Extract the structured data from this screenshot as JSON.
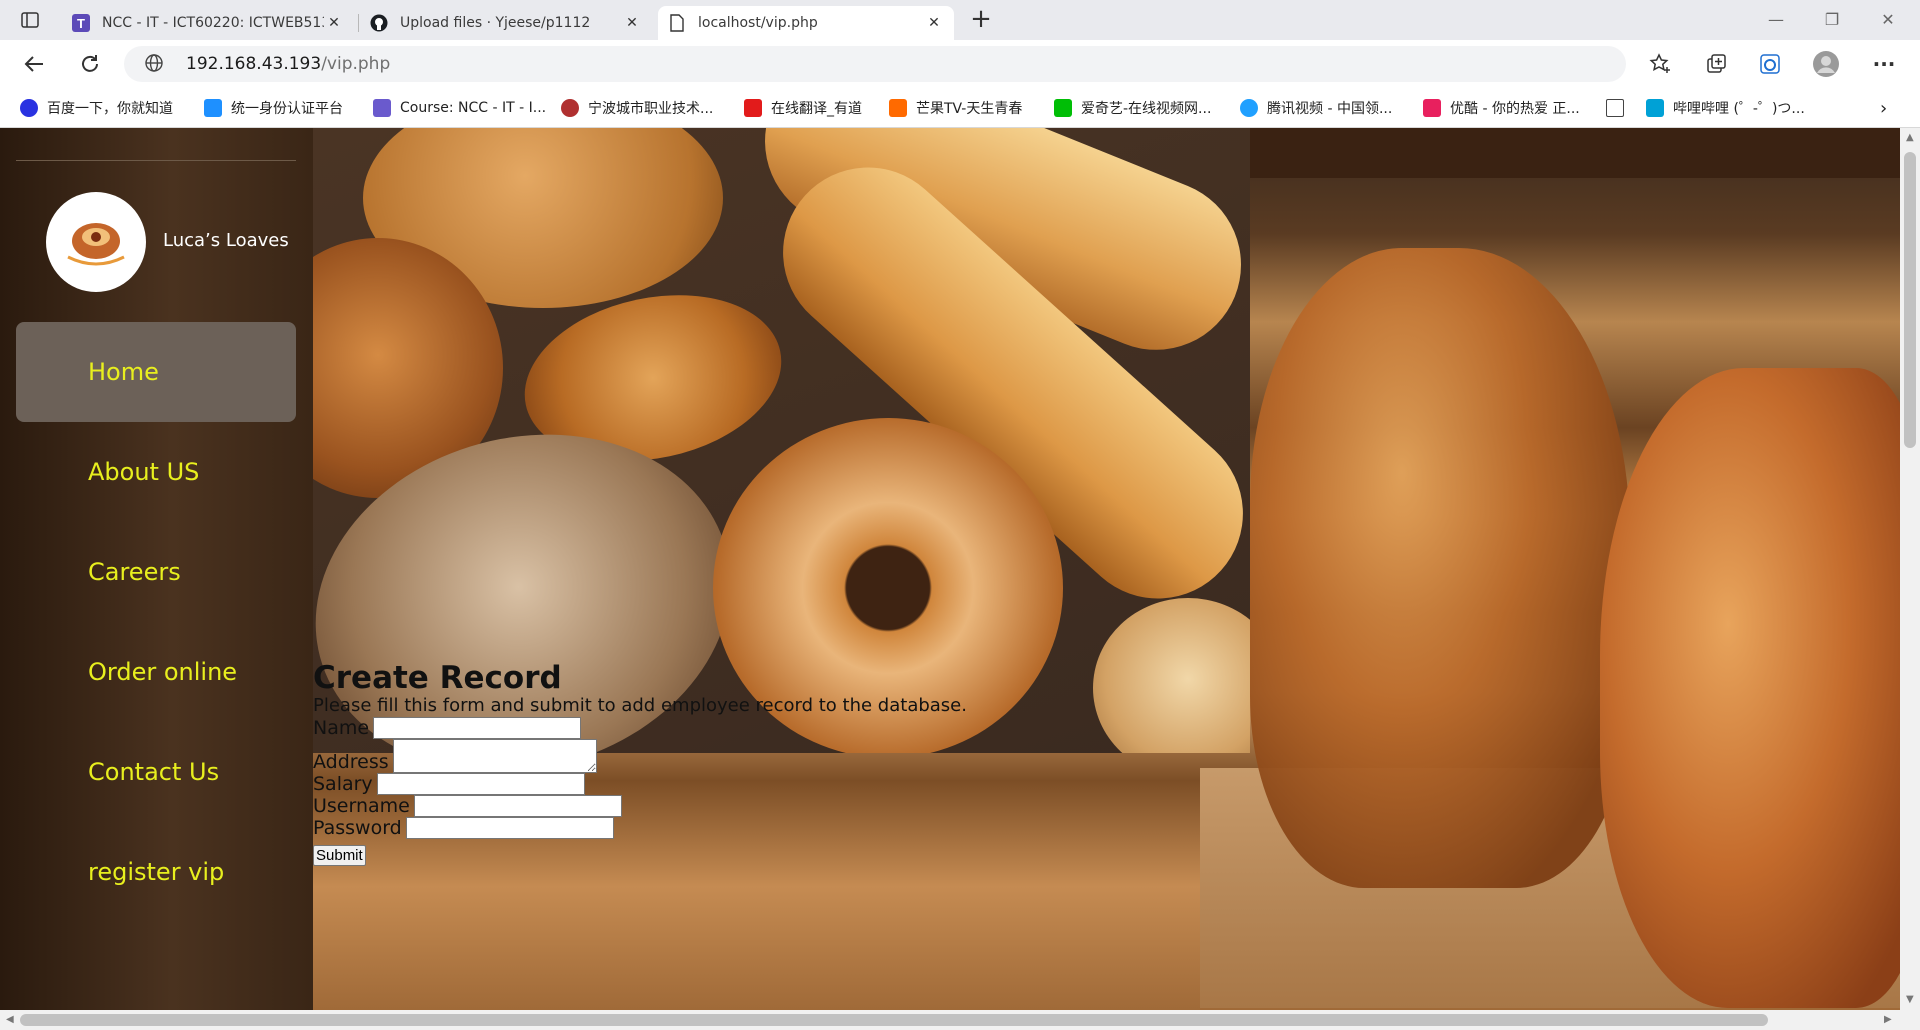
{
  "browser": {
    "tabs": [
      {
        "title": "NCC - IT - ICT60220: ICTWEB513",
        "icon": "t-box-icon",
        "active": false
      },
      {
        "title": "Upload files · Yjeese/p1112",
        "icon": "github-icon",
        "active": false
      },
      {
        "title": "localhost/vip.php",
        "icon": "page-icon",
        "active": true
      }
    ],
    "new_tab": "+",
    "address": {
      "host": "192.168.43.193",
      "path": "/vip.php"
    },
    "bookmarks": [
      {
        "label": "百度一下，你就知道",
        "color": "#2932e1"
      },
      {
        "label": "统一身份认证平台",
        "color": "#1e90ff"
      },
      {
        "label": "Course: NCC - IT - I...",
        "color": "#6a5acd"
      },
      {
        "label": "宁波城市职业技术...",
        "color": "#b03030"
      },
      {
        "label": "在线翻译_有道",
        "color": "#e21b1b"
      },
      {
        "label": "芒果TV-天生青春",
        "color": "#ff6a00"
      },
      {
        "label": "爱奇艺-在线视频网...",
        "color": "#00be06"
      },
      {
        "label": "腾讯视频 - 中国领...",
        "color": "#20a0ff"
      },
      {
        "label": "优酷 - 你的热爱 正...",
        "color": "#e8205e"
      },
      {
        "label": "",
        "color": "#444444"
      },
      {
        "label": "哔哩哔哩 (゜-゜)つ...",
        "color": "#00a1d6"
      }
    ]
  },
  "sidebar": {
    "brand": "Luca’s Loaves",
    "items": [
      {
        "label": "Home",
        "active": true
      },
      {
        "label": "About US"
      },
      {
        "label": "Careers"
      },
      {
        "label": "Order online"
      },
      {
        "label": "Contact Us"
      },
      {
        "label": "register vip"
      }
    ],
    "link_color": "#e8ef1e"
  },
  "form": {
    "title": "Create Record",
    "intro": "Please fill this form and submit to add employee record to the database.",
    "fields": [
      {
        "label": "Name",
        "value": ""
      },
      {
        "label": "Address",
        "value": ""
      },
      {
        "label": "Salary",
        "value": ""
      },
      {
        "label": "Username",
        "value": ""
      },
      {
        "label": "Password",
        "value": ""
      }
    ],
    "submit": "Submit"
  }
}
